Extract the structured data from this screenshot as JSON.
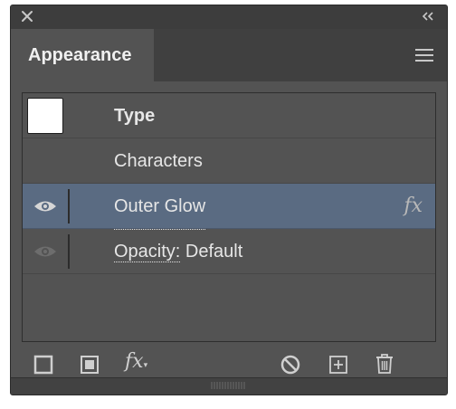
{
  "panel": {
    "title": "Appearance",
    "close_icon": "close-icon",
    "collapse_icon": "double-chevron-left-icon",
    "menu_icon": "hamburger-menu-icon"
  },
  "rows": [
    {
      "label": "Type",
      "kind": "header"
    },
    {
      "label": "Characters",
      "kind": "item"
    },
    {
      "label": "Outer Glow",
      "kind": "effect",
      "selected": true,
      "fx_label": "fx"
    },
    {
      "label": "Opacity:",
      "value": " Default",
      "kind": "item"
    }
  ],
  "toolbar": {
    "fx_label": "fx",
    "icons": [
      "add-new-stroke-icon",
      "add-new-fill-icon",
      "add-new-effect-icon",
      "clear-appearance-icon",
      "duplicate-item-icon",
      "delete-item-icon"
    ]
  },
  "colors": {
    "panel_bg": "#535353",
    "selected_row": "#5a6b82",
    "text": "#e6e6e6"
  }
}
